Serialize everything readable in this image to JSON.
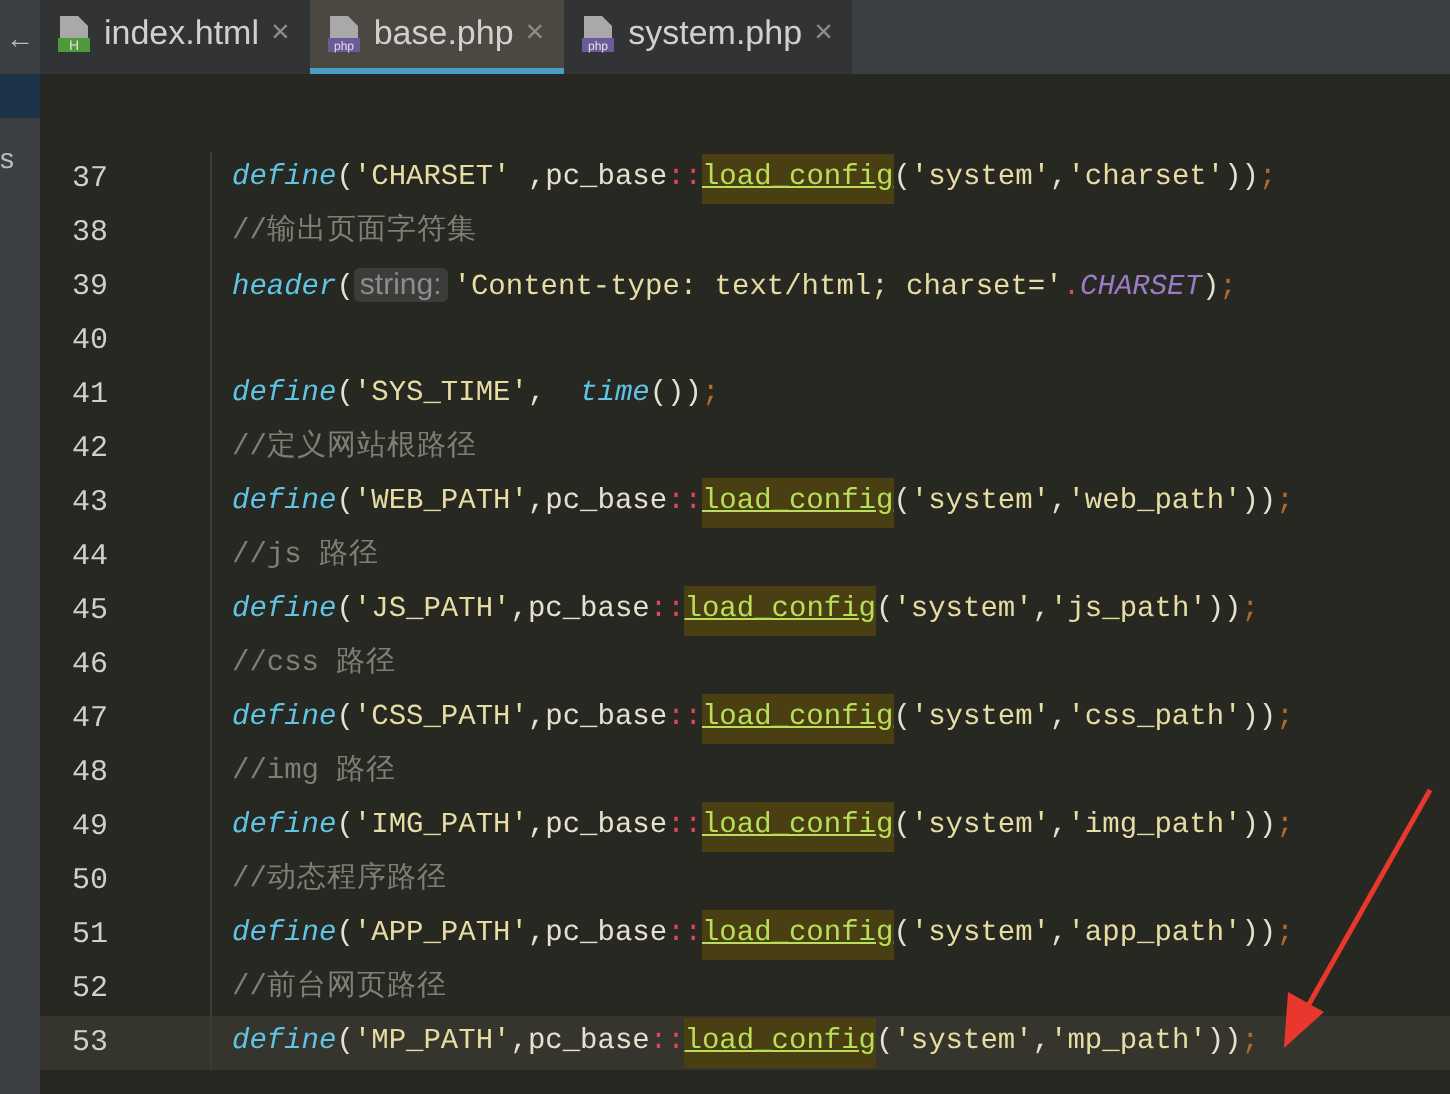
{
  "left_strip": {
    "back": "←",
    "label": "s"
  },
  "tabs": [
    {
      "label": "index.html",
      "badge": "H",
      "kind": "html",
      "selected": false,
      "close": "×"
    },
    {
      "label": "base.php",
      "badge": "php",
      "kind": "php",
      "selected": true,
      "close": "×"
    },
    {
      "label": "system.php",
      "badge": "php",
      "kind": "php",
      "selected": false,
      "close": "×"
    }
  ],
  "lines": [
    {
      "number": "37",
      "current": false,
      "tokens": [
        {
          "kind": "fn",
          "text": "define"
        },
        {
          "kind": "plain",
          "text": "("
        },
        {
          "kind": "str",
          "text": "'CHARSET'"
        },
        {
          "kind": "plain",
          "text": " ,pc_base"
        },
        {
          "kind": "op",
          "text": "::"
        },
        {
          "kind": "call",
          "text": "load_config"
        },
        {
          "kind": "plain",
          "text": "("
        },
        {
          "kind": "str",
          "text": "'system'"
        },
        {
          "kind": "plain",
          "text": ","
        },
        {
          "kind": "str",
          "text": "'charset'"
        },
        {
          "kind": "plain",
          "text": "))"
        },
        {
          "kind": "semi",
          "text": ";"
        }
      ]
    },
    {
      "number": "38",
      "current": false,
      "tokens": [
        {
          "kind": "comment",
          "text": "//输出页面字符集"
        }
      ]
    },
    {
      "number": "39",
      "current": false,
      "tokens": [
        {
          "kind": "fn",
          "text": "header"
        },
        {
          "kind": "plain",
          "text": "("
        },
        {
          "kind": "hint",
          "text": "string:"
        },
        {
          "kind": "str",
          "text": "'Content-type: text/html; charset='"
        },
        {
          "kind": "op",
          "text": "."
        },
        {
          "kind": "const",
          "text": "CHARSET"
        },
        {
          "kind": "plain",
          "text": ")"
        },
        {
          "kind": "semi",
          "text": ";"
        }
      ]
    },
    {
      "number": "40",
      "current": false
    },
    {
      "number": "41",
      "current": false,
      "tokens": [
        {
          "kind": "fn",
          "text": "define"
        },
        {
          "kind": "plain",
          "text": "("
        },
        {
          "kind": "str",
          "text": "'SYS_TIME'"
        },
        {
          "kind": "plain",
          "text": ",  "
        },
        {
          "kind": "fn",
          "text": "time"
        },
        {
          "kind": "plain",
          "text": "())"
        },
        {
          "kind": "semi",
          "text": ";"
        }
      ]
    },
    {
      "number": "42",
      "current": false,
      "tokens": [
        {
          "kind": "comment",
          "text": "//定义网站根路径"
        }
      ]
    },
    {
      "number": "43",
      "current": false,
      "tokens": [
        {
          "kind": "fn",
          "text": "define"
        },
        {
          "kind": "plain",
          "text": "("
        },
        {
          "kind": "str",
          "text": "'WEB_PATH'"
        },
        {
          "kind": "plain",
          "text": ",pc_base"
        },
        {
          "kind": "op",
          "text": "::"
        },
        {
          "kind": "call",
          "text": "load_config"
        },
        {
          "kind": "plain",
          "text": "("
        },
        {
          "kind": "str",
          "text": "'system'"
        },
        {
          "kind": "plain",
          "text": ","
        },
        {
          "kind": "str",
          "text": "'web_path'"
        },
        {
          "kind": "plain",
          "text": "))"
        },
        {
          "kind": "semi",
          "text": ";"
        }
      ]
    },
    {
      "number": "44",
      "current": false,
      "tokens": [
        {
          "kind": "comment",
          "text": "//js 路径"
        }
      ]
    },
    {
      "number": "45",
      "current": false,
      "tokens": [
        {
          "kind": "fn",
          "text": "define"
        },
        {
          "kind": "plain",
          "text": "("
        },
        {
          "kind": "str",
          "text": "'JS_PATH'"
        },
        {
          "kind": "plain",
          "text": ",pc_base"
        },
        {
          "kind": "op",
          "text": "::"
        },
        {
          "kind": "call",
          "text": "load_config"
        },
        {
          "kind": "plain",
          "text": "("
        },
        {
          "kind": "str",
          "text": "'system'"
        },
        {
          "kind": "plain",
          "text": ","
        },
        {
          "kind": "str",
          "text": "'js_path'"
        },
        {
          "kind": "plain",
          "text": "))"
        },
        {
          "kind": "semi",
          "text": ";"
        }
      ]
    },
    {
      "number": "46",
      "current": false,
      "tokens": [
        {
          "kind": "comment",
          "text": "//css 路径"
        }
      ]
    },
    {
      "number": "47",
      "current": false,
      "tokens": [
        {
          "kind": "fn",
          "text": "define"
        },
        {
          "kind": "plain",
          "text": "("
        },
        {
          "kind": "str",
          "text": "'CSS_PATH'"
        },
        {
          "kind": "plain",
          "text": ",pc_base"
        },
        {
          "kind": "op",
          "text": "::"
        },
        {
          "kind": "call",
          "text": "load_config"
        },
        {
          "kind": "plain",
          "text": "("
        },
        {
          "kind": "str",
          "text": "'system'"
        },
        {
          "kind": "plain",
          "text": ","
        },
        {
          "kind": "str",
          "text": "'css_path'"
        },
        {
          "kind": "plain",
          "text": "))"
        },
        {
          "kind": "semi",
          "text": ";"
        }
      ]
    },
    {
      "number": "48",
      "current": false,
      "tokens": [
        {
          "kind": "comment",
          "text": "//img 路径"
        }
      ]
    },
    {
      "number": "49",
      "current": false,
      "tokens": [
        {
          "kind": "fn",
          "text": "define"
        },
        {
          "kind": "plain",
          "text": "("
        },
        {
          "kind": "str",
          "text": "'IMG_PATH'"
        },
        {
          "kind": "plain",
          "text": ",pc_base"
        },
        {
          "kind": "op",
          "text": "::"
        },
        {
          "kind": "call",
          "text": "load_config"
        },
        {
          "kind": "plain",
          "text": "("
        },
        {
          "kind": "str",
          "text": "'system'"
        },
        {
          "kind": "plain",
          "text": ","
        },
        {
          "kind": "str",
          "text": "'img_path'"
        },
        {
          "kind": "plain",
          "text": "))"
        },
        {
          "kind": "semi",
          "text": ";"
        }
      ]
    },
    {
      "number": "50",
      "current": false,
      "tokens": [
        {
          "kind": "comment",
          "text": "//动态程序路径"
        }
      ]
    },
    {
      "number": "51",
      "current": false,
      "tokens": [
        {
          "kind": "fn",
          "text": "define"
        },
        {
          "kind": "plain",
          "text": "("
        },
        {
          "kind": "str",
          "text": "'APP_PATH'"
        },
        {
          "kind": "plain",
          "text": ",pc_base"
        },
        {
          "kind": "op",
          "text": "::"
        },
        {
          "kind": "call",
          "text": "load_config"
        },
        {
          "kind": "plain",
          "text": "("
        },
        {
          "kind": "str",
          "text": "'system'"
        },
        {
          "kind": "plain",
          "text": ","
        },
        {
          "kind": "str",
          "text": "'app_path'"
        },
        {
          "kind": "plain",
          "text": "))"
        },
        {
          "kind": "semi",
          "text": ";"
        }
      ]
    },
    {
      "number": "52",
      "current": false,
      "tokens": [
        {
          "kind": "comment",
          "text": "//前台网页路径"
        }
      ]
    },
    {
      "number": "53",
      "current": true,
      "tokens": [
        {
          "kind": "fn",
          "text": "define"
        },
        {
          "kind": "plain",
          "text": "("
        },
        {
          "kind": "str",
          "text": "'MP_PATH'"
        },
        {
          "kind": "plain",
          "text": ",pc_base"
        },
        {
          "kind": "op",
          "text": "::"
        },
        {
          "kind": "call",
          "text": "load_config"
        },
        {
          "kind": "plain",
          "text": "("
        },
        {
          "kind": "str",
          "text": "'system'"
        },
        {
          "kind": "plain",
          "text": ","
        },
        {
          "kind": "str",
          "text": "'mp_path'"
        },
        {
          "kind": "plain",
          "text": "))"
        },
        {
          "kind": "semi",
          "text": ";"
        }
      ]
    }
  ]
}
